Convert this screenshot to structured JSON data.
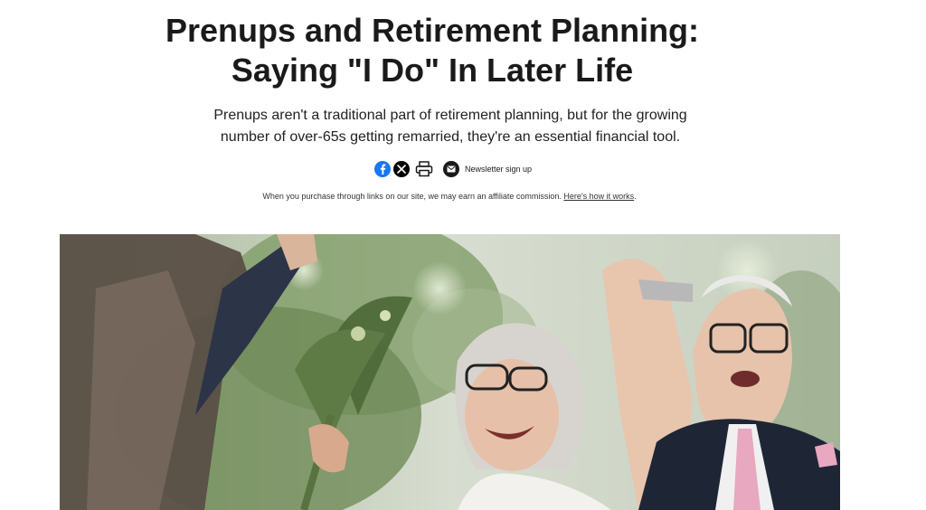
{
  "article": {
    "headline_line1": "Prenups and Retirement Planning:",
    "headline_line2": "Saying \"I Do\" In Later Life",
    "subheadline_line1": "Prenups aren't a traditional part of retirement planning, but for the growing",
    "subheadline_line2": "number of over-65s getting remarried, they're an essential financial tool."
  },
  "share": {
    "icons": [
      "facebook-icon",
      "x-icon",
      "print-icon",
      "mail-icon"
    ],
    "newsletter_label": "Newsletter sign up"
  },
  "affiliate": {
    "text": "When you purchase through links on our site, we may earn an affiliate commission.",
    "link_label": "Here's how it works"
  },
  "colors": {
    "facebook": "#1877f2",
    "x": "#000000",
    "text": "#1a1a1a"
  }
}
